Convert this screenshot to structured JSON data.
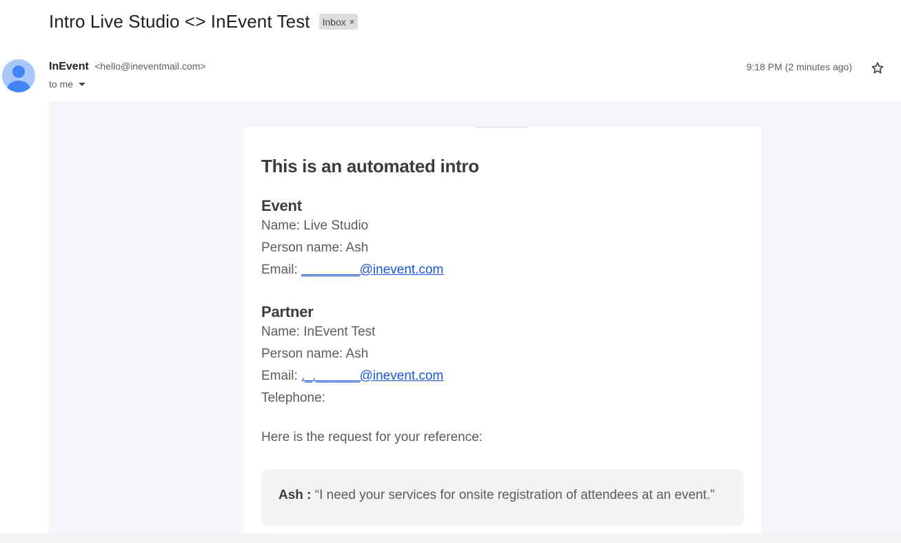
{
  "email": {
    "subject": "Intro Live Studio <> InEvent Test",
    "label": "Inbox",
    "label_close": "×",
    "sender_name": "InEvent",
    "sender_email": "<hello@ineventmail.com>",
    "recipient": "to me",
    "timestamp": "9:18 PM (2 minutes ago)"
  },
  "body": {
    "heading": "This is an automated intro",
    "event": {
      "title": "Event",
      "name": "Name: Live Studio",
      "person": "Person name: Ash",
      "email_label": "Email: ",
      "email_link": "________@inevent.com"
    },
    "partner": {
      "title": "Partner",
      "name": "Name: InEvent Test",
      "person": "Person name: Ash",
      "email_label": "Email: ",
      "email_link": "._.______@inevent.com",
      "telephone": "Telephone:"
    },
    "reference_intro": "Here is the request for your reference:",
    "quote": {
      "author": "Ash : ",
      "text": "“I need your services for onsite registration of attendees at an event.”"
    }
  },
  "colors": {
    "link": "#1a57d6",
    "mail_background": "#f5f6f9",
    "avatar": "#a8c7fa"
  },
  "icons": [
    "avatar-icon",
    "chevron-down-icon",
    "star-icon",
    "close-icon"
  ]
}
